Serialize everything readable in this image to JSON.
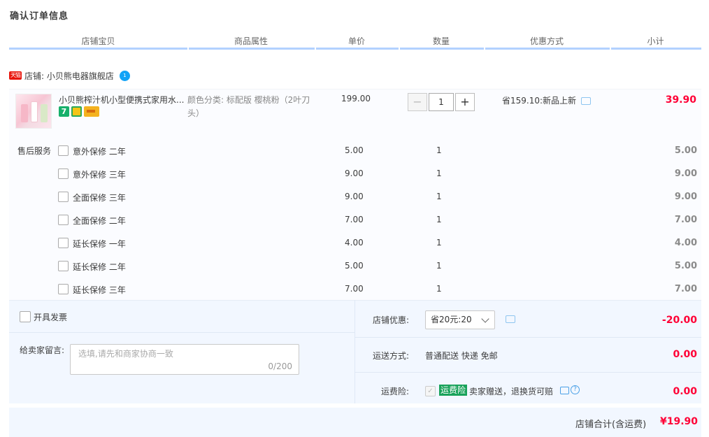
{
  "page_title": "确认订单信息",
  "columns": [
    "店铺宝贝",
    "商品属性",
    "单价",
    "数量",
    "优惠方式",
    "小计"
  ],
  "shop": {
    "badge": "天猫",
    "label": "店铺: 小贝熊电器旗舰店",
    "chat_badge": "1"
  },
  "item": {
    "name": "小贝熊榨汁机小型便携式家用水...",
    "attrs": "颜色分类: 标配版 樱桃粉（2叶刀头）",
    "unit_price": "199.00",
    "qty_minus": "−",
    "qty_value": "1",
    "qty_plus": "+",
    "promo": "省159.10:新品上新",
    "subtotal": "39.90",
    "service_icon_1": "7"
  },
  "aftersale": {
    "label": "售后服务",
    "services": [
      {
        "name": "意外保修 二年",
        "price": "5.00",
        "qty": "1",
        "total": "5.00"
      },
      {
        "name": "意外保修 三年",
        "price": "9.00",
        "qty": "1",
        "total": "9.00"
      },
      {
        "name": "全面保修 三年",
        "price": "9.00",
        "qty": "1",
        "total": "9.00"
      },
      {
        "name": "全面保修 二年",
        "price": "7.00",
        "qty": "1",
        "total": "7.00"
      },
      {
        "name": "延长保修 一年",
        "price": "4.00",
        "qty": "1",
        "total": "4.00"
      },
      {
        "name": "延长保修 二年",
        "price": "5.00",
        "qty": "1",
        "total": "5.00"
      },
      {
        "name": "延长保修 三年",
        "price": "7.00",
        "qty": "1",
        "total": "7.00"
      }
    ]
  },
  "invoice": {
    "label": "开具发票"
  },
  "message": {
    "label": "给卖家留言:",
    "placeholder": "选填,请先和商家协商一致",
    "count": "0/200"
  },
  "shop_discount": {
    "label": "店铺优惠:",
    "selected": "省20元:20",
    "amount": "-20.00"
  },
  "shipping": {
    "label": "运送方式:",
    "value": "普通配送 快递 免邮",
    "amount": "0.00"
  },
  "insurance": {
    "label": "运费险:",
    "check": "✓",
    "badge": "运费险",
    "text": "卖家赠送，退换货可赔",
    "help": "?",
    "amount": "0.00"
  },
  "total": {
    "label": "店铺合计(含运费)",
    "amount": "¥19.90"
  }
}
